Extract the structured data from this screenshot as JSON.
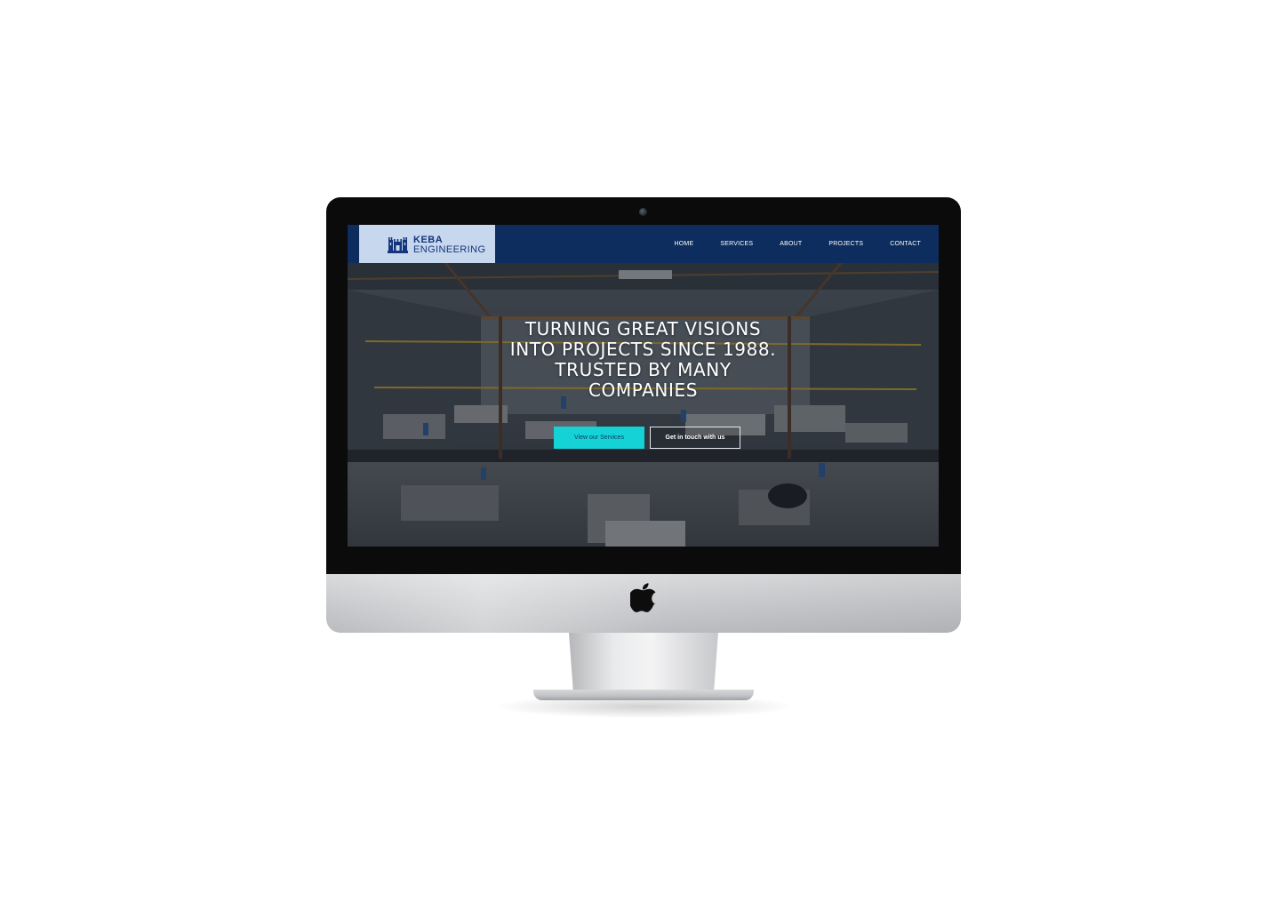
{
  "site": {
    "logo": {
      "line1": "KEBA",
      "line2": "ENGINEERING",
      "icon": "castle-logo-icon"
    },
    "nav": {
      "items": [
        {
          "label": "HOME"
        },
        {
          "label": "SERVICES"
        },
        {
          "label": "ABOUT"
        },
        {
          "label": "PROJECTS"
        },
        {
          "label": "CONTACT"
        }
      ]
    },
    "hero": {
      "title_lines": [
        "TURNING GREAT VISIONS",
        "INTO PROJECTS SINCE 1988.",
        "TRUSTED BY MANY",
        "COMPANIES"
      ],
      "background": "factory-workshop-image",
      "primary_button": "View our Services",
      "secondary_button": "Get in touch with us"
    }
  },
  "device": {
    "type": "imac-mockup",
    "brand_icon": "apple-logo-icon"
  },
  "colors": {
    "navbar": "#0d2d5e",
    "logo_bg": "#c6d7ee",
    "logo_text": "#14357a",
    "accent_button": "#14d2d6",
    "page_bg": "#ffffff"
  }
}
